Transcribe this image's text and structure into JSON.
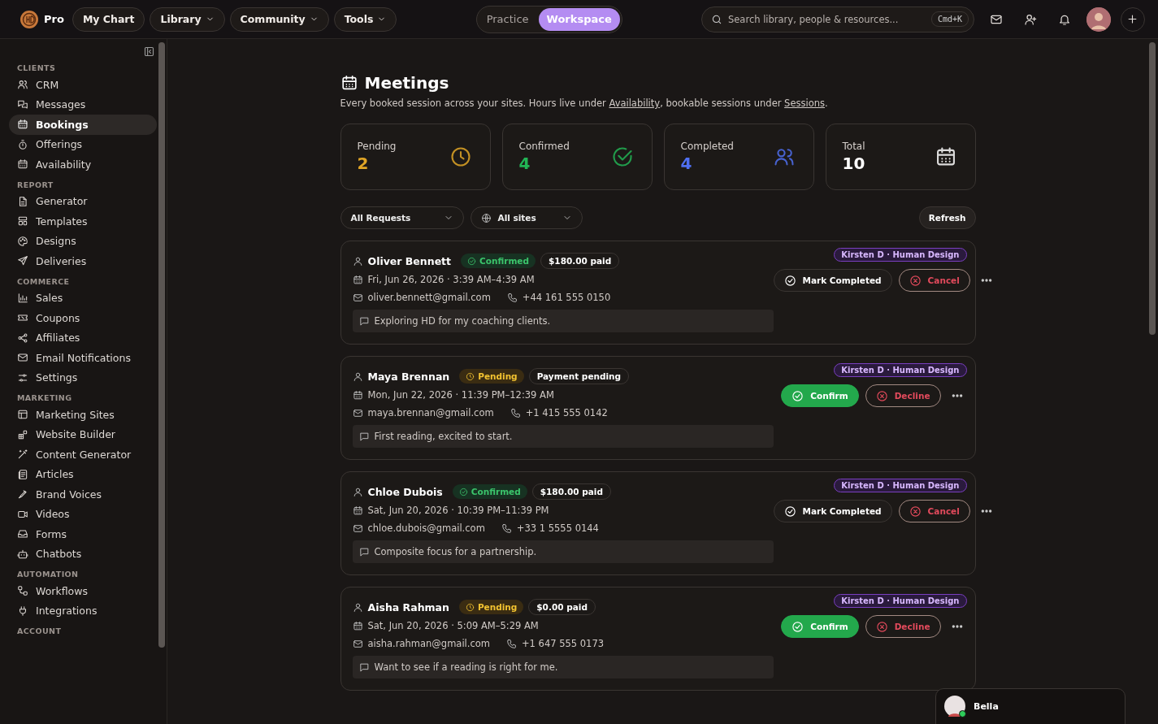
{
  "topbar": {
    "brand": "Pro",
    "nav": [
      {
        "label": "My Chart",
        "dropdown": false
      },
      {
        "label": "Library",
        "dropdown": true
      },
      {
        "label": "Community",
        "dropdown": true
      },
      {
        "label": "Tools",
        "dropdown": true
      }
    ],
    "mode_switch": [
      {
        "label": "Practice",
        "selected": false
      },
      {
        "label": "Workspace",
        "selected": true
      }
    ],
    "search": {
      "placeholder": "Search library, people & resources...",
      "shortcut": "Cmd+K"
    }
  },
  "sidebar": {
    "sections": [
      {
        "heading": "CLIENTS",
        "items": [
          {
            "label": "CRM",
            "selected": false
          },
          {
            "label": "Messages",
            "selected": false
          },
          {
            "label": "Bookings",
            "selected": true
          },
          {
            "label": "Offerings",
            "selected": false
          },
          {
            "label": "Availability",
            "selected": false
          }
        ]
      },
      {
        "heading": "REPORT",
        "items": [
          {
            "label": "Generator",
            "selected": false
          },
          {
            "label": "Templates",
            "selected": false
          },
          {
            "label": "Designs",
            "selected": false
          },
          {
            "label": "Deliveries",
            "selected": false
          }
        ]
      },
      {
        "heading": "COMMERCE",
        "items": [
          {
            "label": "Sales",
            "selected": false
          },
          {
            "label": "Coupons",
            "selected": false
          },
          {
            "label": "Affiliates",
            "selected": false
          },
          {
            "label": "Email Notifications",
            "selected": false
          },
          {
            "label": "Settings",
            "selected": false
          }
        ]
      },
      {
        "heading": "MARKETING",
        "items": [
          {
            "label": "Marketing Sites",
            "selected": false
          },
          {
            "label": "Website Builder",
            "selected": false
          },
          {
            "label": "Content Generator",
            "selected": false
          },
          {
            "label": "Articles",
            "selected": false
          },
          {
            "label": "Brand Voices",
            "selected": false
          },
          {
            "label": "Videos",
            "selected": false
          },
          {
            "label": "Forms",
            "selected": false
          },
          {
            "label": "Chatbots",
            "selected": false
          }
        ]
      },
      {
        "heading": "AUTOMATION",
        "items": [
          {
            "label": "Workflows",
            "selected": false
          },
          {
            "label": "Integrations",
            "selected": false
          }
        ]
      },
      {
        "heading": "ACCOUNT"
      }
    ]
  },
  "page": {
    "title": "Meetings",
    "description": [
      {
        "text": "Every booked session across your sites. Hours live under ",
        "link": false
      },
      {
        "text": "Availability",
        "link": true
      },
      {
        "text": ", bookable sessions under ",
        "link": false
      },
      {
        "text": "Sessions",
        "link": true
      },
      {
        "text": ".",
        "link": false
      }
    ]
  },
  "stats": [
    {
      "label": "Pending",
      "value": "2",
      "color": "#e0a526"
    },
    {
      "label": "Confirmed",
      "value": "4",
      "color": "#22b455"
    },
    {
      "label": "Completed",
      "value": "4",
      "color": "#4f6ff0"
    },
    {
      "label": "Total",
      "value": "10",
      "color": "#ffffff"
    }
  ],
  "filters": [
    {
      "value": "All Requests",
      "icon": false
    },
    {
      "value": "All sites",
      "icon": true
    }
  ],
  "refresh": "Refresh",
  "bookings": [
    {
      "name": "Oliver Bennett",
      "kind": "confirmed",
      "status_label": "Confirmed",
      "payment": "$180.00 paid",
      "date": "Fri, Jun 26, 2026 · 3:39 AM–4:39 AM",
      "email": "oliver.bennett@gmail.com",
      "phone": "+44 161 555 0150",
      "note": "Exploring HD for my coaching clients.",
      "site": "Kirsten D · Human Design",
      "actions": [
        {
          "label": "Mark Completed",
          "kind": "complete"
        },
        {
          "label": "Cancel",
          "kind": "cancel"
        }
      ]
    },
    {
      "name": "Maya Brennan",
      "kind": "pending",
      "status_label": "Pending",
      "payment": "Payment pending",
      "date": "Mon, Jun 22, 2026 · 11:39 PM–12:39 AM",
      "email": "maya.brennan@gmail.com",
      "phone": "+1 415 555 0142",
      "note": "First reading, excited to start.",
      "site": "Kirsten D · Human Design",
      "actions": [
        {
          "label": "Confirm",
          "kind": "confirm"
        },
        {
          "label": "Decline",
          "kind": "cancel"
        }
      ]
    },
    {
      "name": "Chloe Dubois",
      "kind": "confirmed",
      "status_label": "Confirmed",
      "payment": "$180.00 paid",
      "date": "Sat, Jun 20, 2026 · 10:39 PM–11:39 PM",
      "email": "chloe.dubois@gmail.com",
      "phone": "+33 1 5555 0144",
      "note": "Composite focus for a partnership.",
      "site": "Kirsten D · Human Design",
      "actions": [
        {
          "label": "Mark Completed",
          "kind": "complete"
        },
        {
          "label": "Cancel",
          "kind": "cancel"
        }
      ]
    },
    {
      "name": "Aisha Rahman",
      "kind": "pending",
      "status_label": "Pending",
      "payment": "$0.00 paid",
      "date": "Sat, Jun 20, 2026 · 5:09 AM–5:29 AM",
      "email": "aisha.rahman@gmail.com",
      "phone": "+1 647 555 0173",
      "note": "Want to see if a reading is right for me.",
      "site": "Kirsten D · Human Design",
      "actions": [
        {
          "label": "Confirm",
          "kind": "confirm"
        },
        {
          "label": "Decline",
          "kind": "cancel"
        }
      ]
    }
  ],
  "chat": {
    "name": "Bella",
    "online": true
  }
}
